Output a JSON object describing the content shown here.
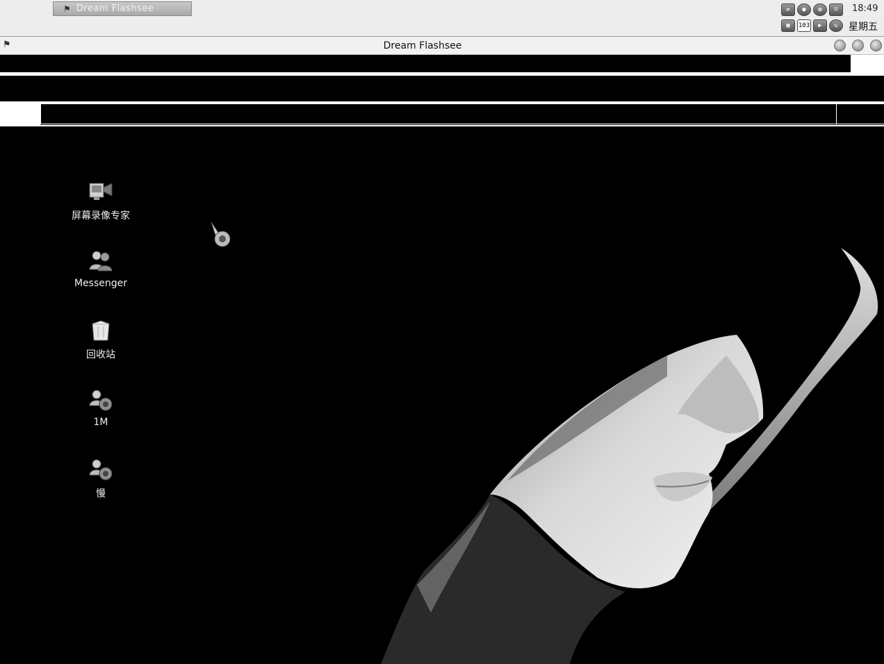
{
  "taskbar": {
    "apple_icon": "apple-icon",
    "task_button_label": "Dream Flashsee",
    "clock": "18:49",
    "weekday": "星期五",
    "tray_icons": [
      "network-icon",
      "chat-icon",
      "globe-icon",
      "user-icon",
      "window-icon",
      "calendar-icon",
      "media-icon",
      "refresh-icon"
    ],
    "calendar_text": "103"
  },
  "window": {
    "title": "Dream Flashsee",
    "buttons": [
      "minimize",
      "maximize",
      "close"
    ]
  },
  "desktop": {
    "icons": [
      {
        "label": "屏幕录像专家",
        "icon": "screen-recorder-icon"
      },
      {
        "label": "Messenger",
        "icon": "messenger-icon"
      },
      {
        "label": "回收站",
        "icon": "recycle-bin-icon"
      },
      {
        "label": "1M",
        "icon": "network-folder-icon"
      },
      {
        "label": "慢",
        "icon": "network-folder-icon"
      }
    ]
  },
  "colors": {
    "background": "#000000",
    "chrome": "#ececec",
    "text_light": "#f0f0f0"
  }
}
